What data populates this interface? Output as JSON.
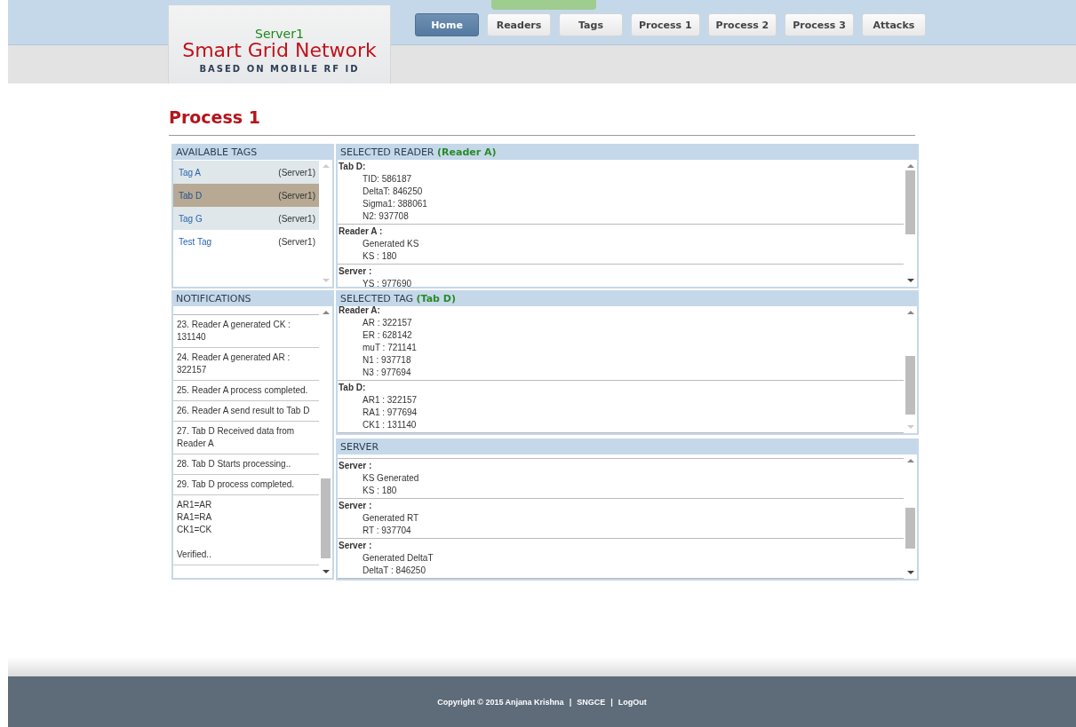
{
  "header": {
    "server": "Server1",
    "title": "Smart Grid Network",
    "subtitle": "BASED ON MOBILE RF ID"
  },
  "nav": [
    {
      "label": "Home",
      "selected": true
    },
    {
      "label": "Readers",
      "selected": false
    },
    {
      "label": "Tags",
      "selected": false
    },
    {
      "label": "Process 1",
      "selected": false
    },
    {
      "label": "Process 2",
      "selected": false
    },
    {
      "label": "Process 3",
      "selected": false
    },
    {
      "label": "Attacks",
      "selected": false
    }
  ],
  "page_title": "Process 1",
  "available_tags": {
    "title": "AVAILABLE TAGS",
    "items": [
      {
        "name": "Tag A",
        "server": "(Server1)",
        "selected": false
      },
      {
        "name": "Tab D",
        "server": "(Server1)",
        "selected": true
      },
      {
        "name": "Tag G",
        "server": "(Server1)",
        "selected": false
      },
      {
        "name": "Test Tag",
        "server": "(Server1)",
        "selected": false
      }
    ]
  },
  "notifications": {
    "title": "NOTIFICATIONS",
    "items": [
      {
        "lines": [
          "23. Reader A generated CK : 131140"
        ]
      },
      {
        "lines": [
          "24. Reader A generated AR : 322157"
        ]
      },
      {
        "lines": [
          "25. Reader A process completed."
        ]
      },
      {
        "lines": [
          "26. Reader A send result to Tab D"
        ]
      },
      {
        "lines": [
          "27. Tab D Received data from Reader A"
        ]
      },
      {
        "lines": [
          "28. Tab D Starts processing.."
        ]
      },
      {
        "lines": [
          "29. Tab D process completed."
        ]
      },
      {
        "lines": [
          "AR1=AR",
          "RA1=RA",
          "CK1=CK"
        ],
        "note": "Verified.."
      }
    ]
  },
  "selected_reader": {
    "title": "SELECTED READER",
    "name": "(Reader A)",
    "groups": [
      {
        "heading": "Tab D:",
        "lines": [
          "TID: 586187",
          "DeltaT: 846250",
          "Sigma1: 388061",
          "N2: 937708"
        ]
      },
      {
        "heading": "Reader A :",
        "lines": [
          "Generated KS",
          "KS : 180"
        ]
      },
      {
        "heading": "Server :",
        "lines": [
          "YS : 977690"
        ]
      }
    ]
  },
  "selected_tag": {
    "title": "SELECTED TAG",
    "name": "(Tab D)",
    "groups": [
      {
        "heading": "Reader A:",
        "lines": [
          "AR : 322157",
          "ER : 628142",
          "muT : 721141",
          "N1 : 937718",
          "N3 : 977694"
        ]
      },
      {
        "heading": "Tab D:",
        "lines": [
          "AR1 : 322157",
          "RA1 : 977694",
          "CK1 : 131140"
        ]
      }
    ]
  },
  "server": {
    "title": "SERVER",
    "groups": [
      {
        "heading": "Server :",
        "lines": [
          "KS Generated",
          "KS : 180"
        ]
      },
      {
        "heading": "Server :",
        "lines": [
          "Generated RT",
          "RT : 937704"
        ]
      },
      {
        "heading": "Server :",
        "lines": [
          "Generated DeltaT",
          "DeltaT : 846250"
        ]
      }
    ]
  },
  "footer": {
    "copyright": "Copyright © 2015 Anjana Krishna",
    "separator_1": "|",
    "org": "SNGCE",
    "separator_2": "|",
    "logout": "LogOut"
  }
}
